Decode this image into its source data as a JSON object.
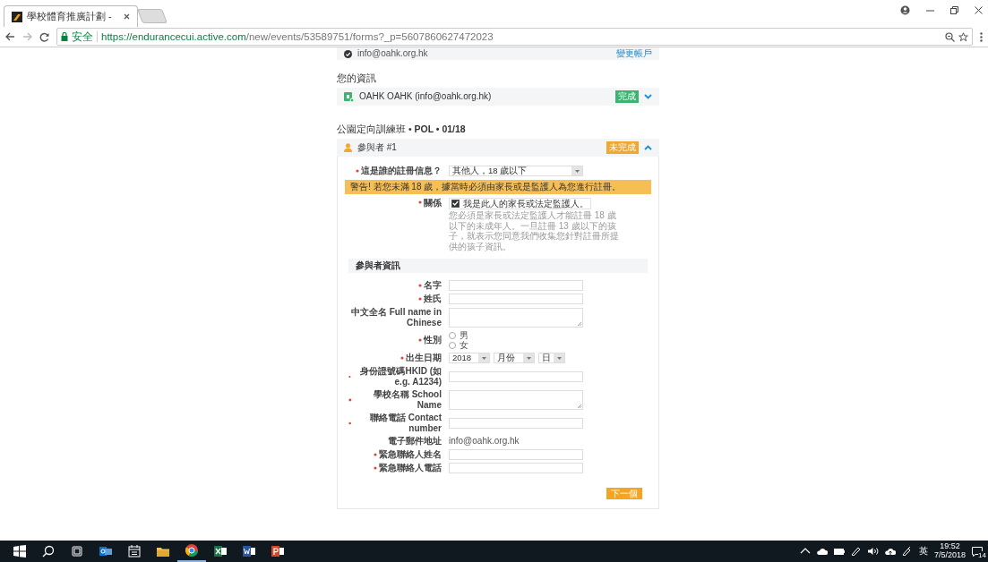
{
  "browser": {
    "tab_title": "學校體育推廣計劃 -",
    "secure_label": "安全",
    "url_host": "https://endurancecui.active.com",
    "url_path": "/new/events/53589751/forms?_p=5607860627472023"
  },
  "account_row": {
    "email": "info@oahk.org.hk",
    "link": "變更帳戶"
  },
  "your_info": {
    "heading": "您的資訊",
    "name": "OAHK OAHK (info@oahk.org.hk)",
    "status": "完成",
    "color": "#3cb371",
    "expanded": false
  },
  "event_title": "公園定向訓練班 • **POL • 01/18**",
  "participant": {
    "title": "參與者 #1",
    "status": "未完成",
    "color": "#f0a830",
    "expanded": true,
    "who_label": "這是誰的註冊信息？",
    "who_value": "其他人，18 歲以下",
    "warning": "警告! 若您未滿 18 歲，據當時必須由家長或是監護人為您進行註冊。",
    "relationship": {
      "label": "關係",
      "checkbox_label": "我是此人的家長或法定監護人。",
      "checked": true,
      "note": "您必須是家長或法定監護人才能註冊 18 歲以下的未成年人。一旦註冊 13 歲以下的孩子，就表示您同意我們收集您針對註冊所提供的孩子資訊。"
    },
    "section_heading": "參與者資訊",
    "fields": [
      {
        "kind": "text",
        "label": "名字",
        "required": true
      },
      {
        "kind": "text",
        "label": "姓氏",
        "required": true
      },
      {
        "kind": "textarea",
        "label": "中文全名 Full name in Chinese",
        "required": false
      },
      {
        "kind": "radio",
        "label": "性別",
        "required": true,
        "options": [
          {
            "label": "男",
            "selected": false
          },
          {
            "label": "女",
            "selected": false
          }
        ]
      },
      {
        "kind": "date",
        "label": "出生日期",
        "required": true,
        "selects": [
          "2018",
          "月份",
          "日"
        ]
      },
      {
        "kind": "text",
        "label": "身份證號碼HKID (如 e.g. A1234)",
        "required": true
      },
      {
        "kind": "textarea",
        "label": "學校名稱 School Name",
        "required": true
      },
      {
        "kind": "text",
        "label": "聯絡電話 Contact number",
        "required": true
      },
      {
        "kind": "static",
        "label": "電子郵件地址",
        "required": false,
        "value": "info@oahk.org.hk"
      },
      {
        "kind": "text",
        "label": "緊急聯絡人姓名",
        "required": true
      },
      {
        "kind": "text",
        "label": "緊急聯絡人電話",
        "required": true
      }
    ],
    "next_button": "下一個"
  },
  "taskbar": {
    "ime": "英",
    "time": "19:52",
    "date": "7/5/2018",
    "notifications": "14"
  }
}
